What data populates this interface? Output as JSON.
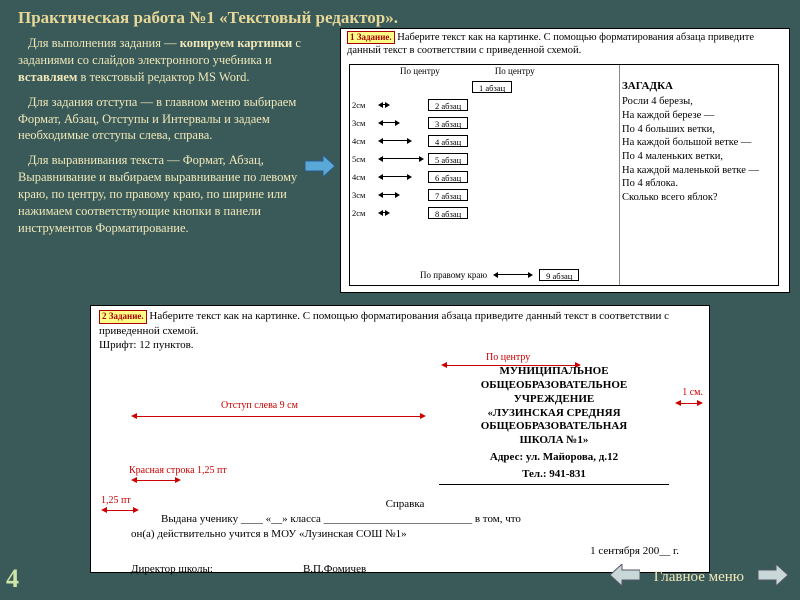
{
  "title": "Практическая работа №1 «Текстовый редактор».",
  "instructions": {
    "p1a": "Для выполнения задания — ",
    "p1b": "копируем картинки",
    "p1c": " с заданиями со слайдов электронного учебника и ",
    "p1d": "вставляем",
    "p1e": " в текстовый редактор MS Word.",
    "p2": "Для задания отступа — в главном меню выбираем  Формат, Абзац, Отступы и Интервалы и задаем необходимые отступы слева, справа.",
    "p3": "Для выравнивания текста — Формат, Абзац, Выравнивание и выбираем выравнивание по левому краю, по центру, по правому краю, по ширине или нажимаем соответствующие кнопки в панели инструментов Форматирование."
  },
  "task1": {
    "badge": "1 Задание.",
    "head": "Наберите текст как на картинке. С помощью форматирования абзаца приведите данный текст в соответствии с приведенной схемой.",
    "top_left": "По центру",
    "top_right": "По центру",
    "rows": [
      {
        "dim": "",
        "label": "1 абзац"
      },
      {
        "dim": "2см",
        "label": "2 абзац"
      },
      {
        "dim": "3см",
        "label": "3 абзац"
      },
      {
        "dim": "4см",
        "label": "4 абзац"
      },
      {
        "dim": "5см",
        "label": "5 абзац"
      },
      {
        "dim": "4см",
        "label": "6 абзац"
      },
      {
        "dim": "3см",
        "label": "7 абзац"
      },
      {
        "dim": "2см",
        "label": "8 абзац"
      },
      {
        "dim": "",
        "label": "9 абзац"
      }
    ],
    "bottom_label": "По правому краю",
    "riddle_title": "ЗАГАДКА",
    "riddle": [
      "Росли 4 березы,",
      "На каждой березе —",
      "По 4 больших ветки,",
      "На каждой большой ветке —",
      "По 4 маленьких ветки,",
      "На каждой маленькой ветке —",
      "По 4 яблока.",
      "Сколько всего яблок?"
    ]
  },
  "task2": {
    "badge": "2 Задание.",
    "head": "Наберите текст как на картинке. С помощью форматирования абзаца приведите данный текст в соответствии с приведенной схемой.",
    "font_note": "Шрифт: 12 пунктов.",
    "labels": {
      "center": "По центру",
      "indent_left": "Отступ слева 9 см",
      "first_line": "Красная строка 1,25 пт",
      "val125": "1,25 пт",
      "right_1cm": "1 см."
    },
    "header_lines": [
      "МУНИЦИПАЛЬНОЕ",
      "ОБЩЕОБРАЗОВАТЕЛЬНОЕ",
      "УЧРЕЖДЕНИЕ",
      "«ЛУЗИНСКАЯ СРЕДНЯЯ",
      "ОБЩЕОБРАЗОВАТЕЛЬНАЯ",
      "ШКОЛА №1»"
    ],
    "address1": "Адрес: ул. Майорова, д.12",
    "address2": "Тел.: 941-831",
    "spravka_title": "Справка",
    "spravka_line1": "Выдана ученику ____ «__» класса ___________________________ в том, что",
    "spravka_line2": "он(а) действительно учится в МОУ «Лузинская СОШ №1»",
    "date": "1 сентября 200__ г.",
    "director_label": "Директор школы:",
    "director_name": "В.П.Фомичев"
  },
  "nav": {
    "main_menu": "Главное меню"
  },
  "page_number": "4",
  "colors": {
    "bg": "#3a5a5a",
    "accent": "#e8d898",
    "red": "#c00"
  }
}
